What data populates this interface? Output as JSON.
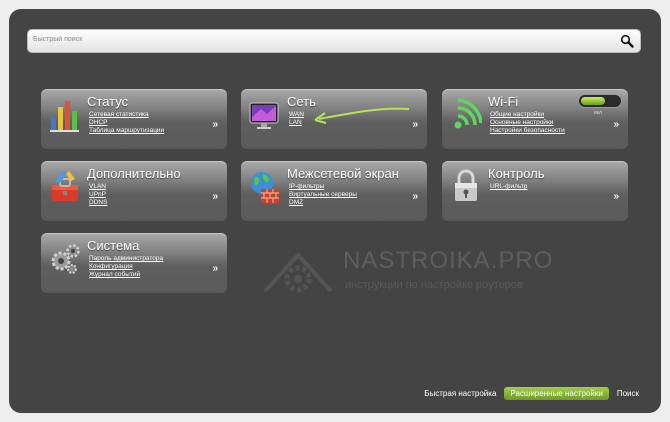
{
  "search": {
    "placeholder": "Быстрый поиск"
  },
  "tiles": [
    {
      "title": "Статус",
      "links": [
        "Сетевая статистика",
        "DHCP",
        "Таблица маршрутизации"
      ],
      "arrow": "»",
      "icon": "status-chart-icon"
    },
    {
      "title": "Сеть",
      "links": [
        "WAN",
        "LAN"
      ],
      "arrow": "»",
      "icon": "network-monitor-icon"
    },
    {
      "title": "Wi-Fi",
      "links": [
        "Общие настройки",
        "Основные настройки",
        "Настройки безопасности"
      ],
      "arrow": "»",
      "icon": "wifi-icon",
      "toggle_label": "вкл"
    },
    {
      "title": "Дополнительно",
      "links": [
        "VLAN",
        "UPnP",
        "DDNS"
      ],
      "arrow": "»",
      "icon": "toolbox-icon"
    },
    {
      "title": "Межсетевой экран",
      "links": [
        "IP-фильтры",
        "Виртуальные серверы",
        "DMZ"
      ],
      "arrow": "»",
      "icon": "firewall-globe-icon"
    },
    {
      "title": "Контроль",
      "links": [
        "URL-фильтр"
      ],
      "arrow": "»",
      "icon": "padlock-icon"
    },
    {
      "title": "Система",
      "links": [
        "Пароль администратора",
        "Конфигурация",
        "Журнал событий"
      ],
      "arrow": "»",
      "icon": "gears-icon"
    }
  ],
  "watermark": {
    "brand": "NASTROIKA.PRO",
    "subtitle": "инструкции по настройке роутеров"
  },
  "footer": {
    "quick_setup": "Быстрая настройка",
    "advanced": "Расширенные настройки",
    "search": "Поиск"
  },
  "colors": {
    "accent": "#7fb52b",
    "panel": "#444444",
    "tile": "#7a7a7a"
  }
}
